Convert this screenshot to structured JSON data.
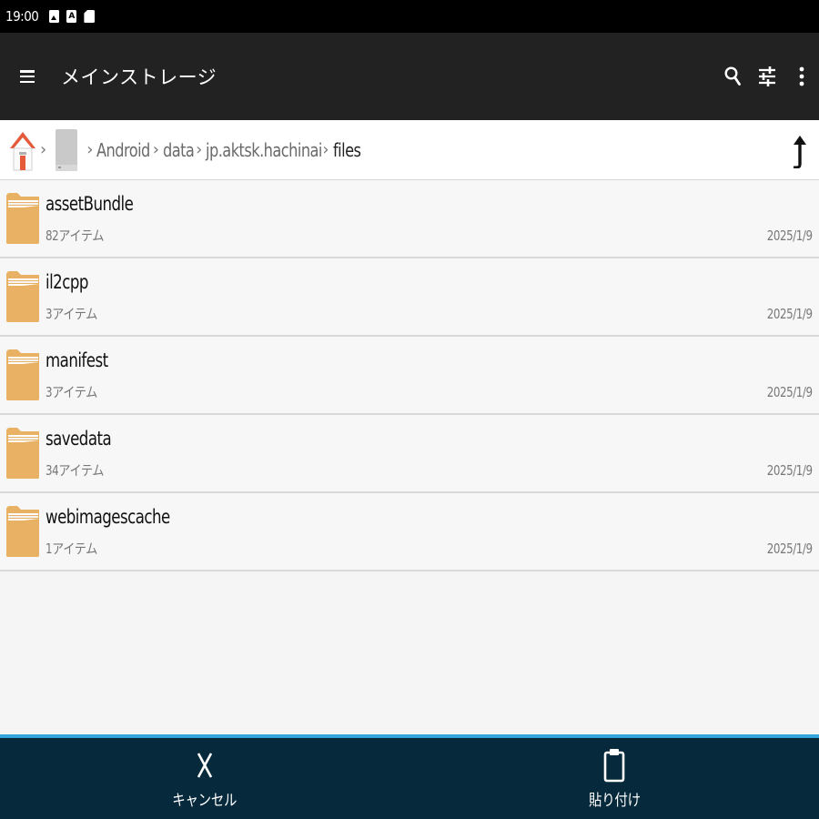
{
  "status_bar": {
    "time": "19:00",
    "icons": [
      "image-icon",
      "text-a-icon",
      "sd-card-icon"
    ]
  },
  "app_bar": {
    "title": "メインストレージ",
    "actions": [
      "search-icon",
      "filter-sliders-icon",
      "more-vert-icon"
    ]
  },
  "breadcrumb": {
    "segments": [
      "Android",
      "data",
      "jp.aktsk.hachinai",
      "files"
    ],
    "current": "files"
  },
  "files": [
    {
      "name": "assetBundle",
      "count": "82アイテム",
      "date": "2025/1/9"
    },
    {
      "name": "il2cpp",
      "count": "3アイテム",
      "date": "2025/1/9"
    },
    {
      "name": "manifest",
      "count": "3アイテム",
      "date": "2025/1/9"
    },
    {
      "name": "savedata",
      "count": "34アイテム",
      "date": "2025/1/9"
    },
    {
      "name": "webimagescache",
      "count": "1アイテム",
      "date": "2025/1/9"
    }
  ],
  "bottom_bar": {
    "cancel_label": "キャンセル",
    "paste_label": "貼り付け"
  },
  "colors": {
    "app_bar": "#222222",
    "bottom_bar": "#062a3c",
    "bottom_accent": "#32a6dc",
    "folder": "#e8b164"
  }
}
